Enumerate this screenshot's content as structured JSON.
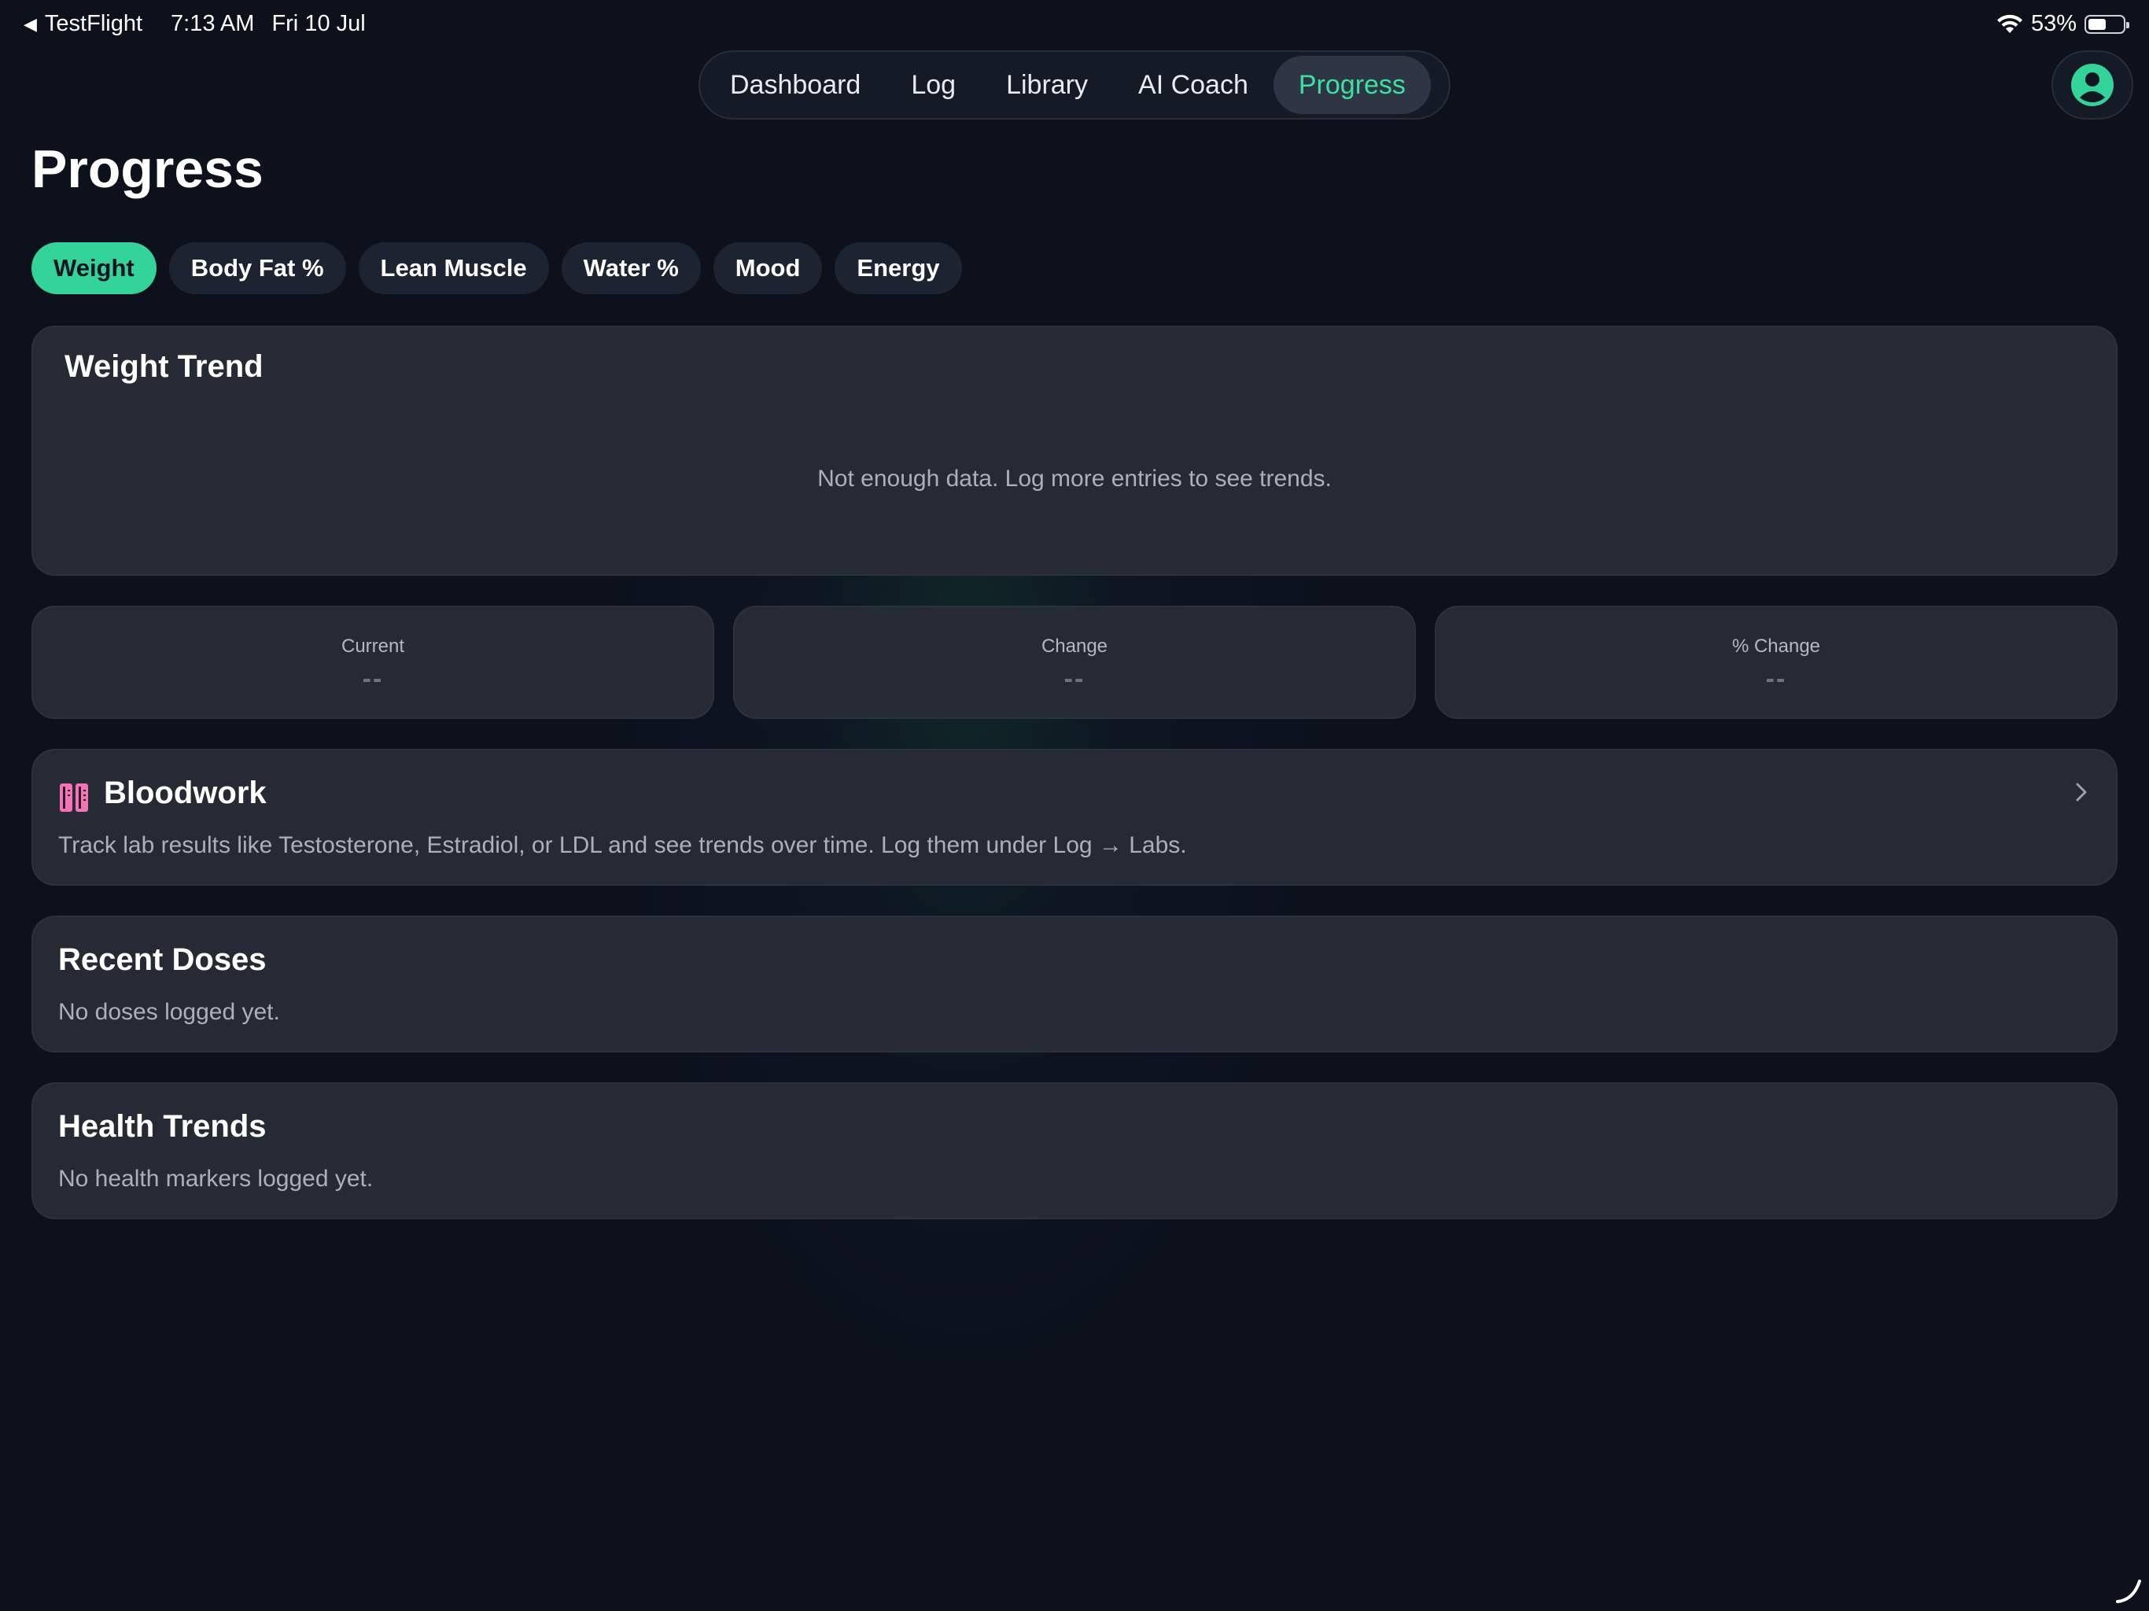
{
  "status_bar": {
    "back_app": "TestFlight",
    "time": "7:13 AM",
    "date": "Fri 10 Jul",
    "battery_percent": "53%",
    "battery_level": 0.53
  },
  "nav": {
    "tabs": [
      {
        "label": "Dashboard",
        "active": false
      },
      {
        "label": "Log",
        "active": false
      },
      {
        "label": "Library",
        "active": false
      },
      {
        "label": "AI Coach",
        "active": false
      },
      {
        "label": "Progress",
        "active": true
      }
    ],
    "accent_color": "#3de0a0"
  },
  "page": {
    "title": "Progress"
  },
  "metrics": {
    "chips": [
      {
        "label": "Weight",
        "active": true
      },
      {
        "label": "Body Fat %",
        "active": false
      },
      {
        "label": "Lean Muscle",
        "active": false
      },
      {
        "label": "Water %",
        "active": false
      },
      {
        "label": "Mood",
        "active": false
      },
      {
        "label": "Energy",
        "active": false
      }
    ],
    "active_color": "#34d399"
  },
  "trend": {
    "title": "Weight Trend",
    "empty_message": "Not enough data. Log more entries to see trends."
  },
  "stats": {
    "current": {
      "label": "Current",
      "value": "--"
    },
    "change": {
      "label": "Change",
      "value": "--"
    },
    "percent_change": {
      "label": "% Change",
      "value": "--"
    }
  },
  "bloodwork": {
    "icon": "test-tubes-icon",
    "title": "Bloodwork",
    "description": "Track lab results like Testosterone, Estradiol, or LDL and see trends over time. Log them under Log → Labs.",
    "icon_color": "#f472b6"
  },
  "recent_doses": {
    "title": "Recent Doses",
    "empty_message": "No doses logged yet."
  },
  "health_trends": {
    "title": "Health Trends",
    "empty_message": "No health markers logged yet."
  }
}
